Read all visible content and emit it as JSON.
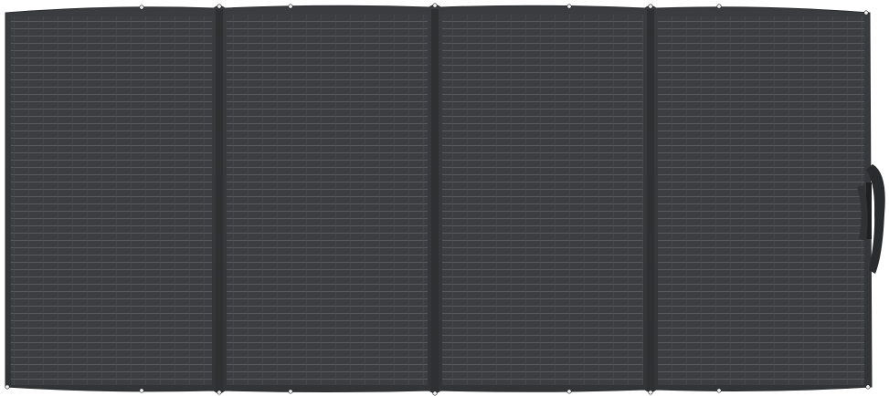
{
  "product": {
    "subject": "solar-panel",
    "panel_count": 4
  },
  "colors": {
    "background": "#ffffff",
    "frame": "#36383a",
    "frame_edge": "#2b2d2f",
    "cell_area": "#3c3e41",
    "cell_row_line": "#5a5d60",
    "cell_col_line": "#4a4d50",
    "hinge": "#2e3032",
    "grommet": "#f2f2f2",
    "strap": "#2a2b2d"
  },
  "icons": {
    "grommet": "grommet-icon",
    "strap": "carry-strap-icon"
  }
}
